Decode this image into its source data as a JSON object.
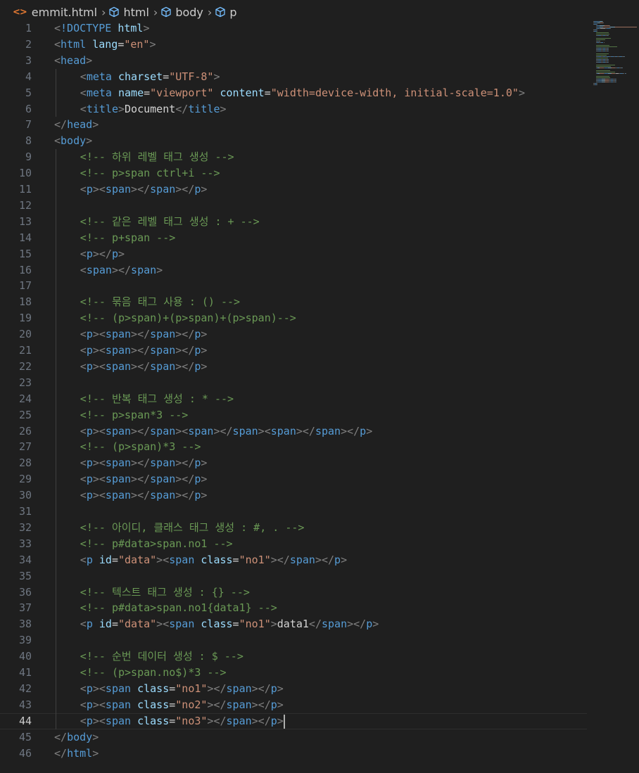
{
  "breadcrumb": {
    "file_icon": "<>",
    "items": [
      "emmit.html",
      "html",
      "body",
      "p"
    ]
  },
  "editor": {
    "active_line": 44,
    "lines": [
      {
        "n": "1",
        "indent": 0,
        "tokens": [
          [
            "b",
            "<"
          ],
          [
            "t",
            "!DOCTYPE "
          ],
          [
            "a",
            "html"
          ],
          [
            "b",
            ">"
          ]
        ]
      },
      {
        "n": "2",
        "indent": 0,
        "tokens": [
          [
            "b",
            "<"
          ],
          [
            "t",
            "html "
          ],
          [
            "a",
            "lang"
          ],
          [
            "x",
            "="
          ],
          [
            "s",
            "\"en\""
          ],
          [
            "b",
            ">"
          ]
        ]
      },
      {
        "n": "3",
        "indent": 0,
        "tokens": [
          [
            "b",
            "<"
          ],
          [
            "t",
            "head"
          ],
          [
            "b",
            ">"
          ]
        ]
      },
      {
        "n": "4",
        "indent": 1,
        "tokens": [
          [
            "b",
            "<"
          ],
          [
            "t",
            "meta "
          ],
          [
            "a",
            "charset"
          ],
          [
            "x",
            "="
          ],
          [
            "s",
            "\"UTF-8\""
          ],
          [
            "b",
            ">"
          ]
        ]
      },
      {
        "n": "5",
        "indent": 1,
        "tokens": [
          [
            "b",
            "<"
          ],
          [
            "t",
            "meta "
          ],
          [
            "a",
            "name"
          ],
          [
            "x",
            "="
          ],
          [
            "s",
            "\"viewport\""
          ],
          [
            "x",
            " "
          ],
          [
            "a",
            "content"
          ],
          [
            "x",
            "="
          ],
          [
            "s",
            "\"width=device-width, initial-scale=1.0\""
          ],
          [
            "b",
            ">"
          ]
        ]
      },
      {
        "n": "6",
        "indent": 1,
        "tokens": [
          [
            "b",
            "<"
          ],
          [
            "t",
            "title"
          ],
          [
            "b",
            ">"
          ],
          [
            "x",
            "Document"
          ],
          [
            "b",
            "</"
          ],
          [
            "t",
            "title"
          ],
          [
            "b",
            ">"
          ]
        ]
      },
      {
        "n": "7",
        "indent": 0,
        "tokens": [
          [
            "b",
            "</"
          ],
          [
            "t",
            "head"
          ],
          [
            "b",
            ">"
          ]
        ]
      },
      {
        "n": "8",
        "indent": 0,
        "tokens": [
          [
            "b",
            "<"
          ],
          [
            "t",
            "body"
          ],
          [
            "b",
            ">"
          ]
        ]
      },
      {
        "n": "9",
        "indent": 1,
        "tokens": [
          [
            "c",
            "<!-- 하위 레벨 태그 생성 -->"
          ]
        ]
      },
      {
        "n": "10",
        "indent": 1,
        "tokens": [
          [
            "c",
            "<!-- p>span ctrl+i -->"
          ]
        ]
      },
      {
        "n": "11",
        "indent": 1,
        "tokens": [
          [
            "b",
            "<"
          ],
          [
            "t",
            "p"
          ],
          [
            "b",
            "><"
          ],
          [
            "t",
            "span"
          ],
          [
            "b",
            "></"
          ],
          [
            "t",
            "span"
          ],
          [
            "b",
            "></"
          ],
          [
            "t",
            "p"
          ],
          [
            "b",
            ">"
          ]
        ]
      },
      {
        "n": "12",
        "indent": 0,
        "tokens": []
      },
      {
        "n": "13",
        "indent": 1,
        "tokens": [
          [
            "c",
            "<!-- 같은 레벨 태그 생성 : + -->"
          ]
        ]
      },
      {
        "n": "14",
        "indent": 1,
        "tokens": [
          [
            "c",
            "<!-- p+span -->"
          ]
        ]
      },
      {
        "n": "15",
        "indent": 1,
        "tokens": [
          [
            "b",
            "<"
          ],
          [
            "t",
            "p"
          ],
          [
            "b",
            "></"
          ],
          [
            "t",
            "p"
          ],
          [
            "b",
            ">"
          ]
        ]
      },
      {
        "n": "16",
        "indent": 1,
        "tokens": [
          [
            "b",
            "<"
          ],
          [
            "t",
            "span"
          ],
          [
            "b",
            "></"
          ],
          [
            "t",
            "span"
          ],
          [
            "b",
            ">"
          ]
        ]
      },
      {
        "n": "17",
        "indent": 0,
        "tokens": []
      },
      {
        "n": "18",
        "indent": 1,
        "tokens": [
          [
            "c",
            "<!-- 묶음 태그 사용 : () -->"
          ]
        ]
      },
      {
        "n": "19",
        "indent": 1,
        "tokens": [
          [
            "c",
            "<!-- (p>span)+(p>span)+(p>span)-->"
          ]
        ]
      },
      {
        "n": "20",
        "indent": 1,
        "tokens": [
          [
            "b",
            "<"
          ],
          [
            "t",
            "p"
          ],
          [
            "b",
            "><"
          ],
          [
            "t",
            "span"
          ],
          [
            "b",
            "></"
          ],
          [
            "t",
            "span"
          ],
          [
            "b",
            "></"
          ],
          [
            "t",
            "p"
          ],
          [
            "b",
            ">"
          ]
        ]
      },
      {
        "n": "21",
        "indent": 1,
        "tokens": [
          [
            "b",
            "<"
          ],
          [
            "t",
            "p"
          ],
          [
            "b",
            "><"
          ],
          [
            "t",
            "span"
          ],
          [
            "b",
            "></"
          ],
          [
            "t",
            "span"
          ],
          [
            "b",
            "></"
          ],
          [
            "t",
            "p"
          ],
          [
            "b",
            ">"
          ]
        ]
      },
      {
        "n": "22",
        "indent": 1,
        "tokens": [
          [
            "b",
            "<"
          ],
          [
            "t",
            "p"
          ],
          [
            "b",
            "><"
          ],
          [
            "t",
            "span"
          ],
          [
            "b",
            "></"
          ],
          [
            "t",
            "span"
          ],
          [
            "b",
            "></"
          ],
          [
            "t",
            "p"
          ],
          [
            "b",
            ">"
          ]
        ]
      },
      {
        "n": "23",
        "indent": 0,
        "tokens": []
      },
      {
        "n": "24",
        "indent": 1,
        "tokens": [
          [
            "c",
            "<!-- 반복 태그 생성 : * -->"
          ]
        ]
      },
      {
        "n": "25",
        "indent": 1,
        "tokens": [
          [
            "c",
            "<!-- p>span*3 -->"
          ]
        ]
      },
      {
        "n": "26",
        "indent": 1,
        "tokens": [
          [
            "b",
            "<"
          ],
          [
            "t",
            "p"
          ],
          [
            "b",
            "><"
          ],
          [
            "t",
            "span"
          ],
          [
            "b",
            "></"
          ],
          [
            "t",
            "span"
          ],
          [
            "b",
            "><"
          ],
          [
            "t",
            "span"
          ],
          [
            "b",
            "></"
          ],
          [
            "t",
            "span"
          ],
          [
            "b",
            "><"
          ],
          [
            "t",
            "span"
          ],
          [
            "b",
            "></"
          ],
          [
            "t",
            "span"
          ],
          [
            "b",
            "></"
          ],
          [
            "t",
            "p"
          ],
          [
            "b",
            ">"
          ]
        ]
      },
      {
        "n": "27",
        "indent": 1,
        "tokens": [
          [
            "c",
            "<!-- (p>span)*3 -->"
          ]
        ]
      },
      {
        "n": "28",
        "indent": 1,
        "tokens": [
          [
            "b",
            "<"
          ],
          [
            "t",
            "p"
          ],
          [
            "b",
            "><"
          ],
          [
            "t",
            "span"
          ],
          [
            "b",
            "></"
          ],
          [
            "t",
            "span"
          ],
          [
            "b",
            "></"
          ],
          [
            "t",
            "p"
          ],
          [
            "b",
            ">"
          ]
        ]
      },
      {
        "n": "29",
        "indent": 1,
        "tokens": [
          [
            "b",
            "<"
          ],
          [
            "t",
            "p"
          ],
          [
            "b",
            "><"
          ],
          [
            "t",
            "span"
          ],
          [
            "b",
            "></"
          ],
          [
            "t",
            "span"
          ],
          [
            "b",
            "></"
          ],
          [
            "t",
            "p"
          ],
          [
            "b",
            ">"
          ]
        ]
      },
      {
        "n": "30",
        "indent": 1,
        "tokens": [
          [
            "b",
            "<"
          ],
          [
            "t",
            "p"
          ],
          [
            "b",
            "><"
          ],
          [
            "t",
            "span"
          ],
          [
            "b",
            "></"
          ],
          [
            "t",
            "span"
          ],
          [
            "b",
            "></"
          ],
          [
            "t",
            "p"
          ],
          [
            "b",
            ">"
          ]
        ]
      },
      {
        "n": "31",
        "indent": 0,
        "tokens": []
      },
      {
        "n": "32",
        "indent": 1,
        "tokens": [
          [
            "c",
            "<!-- 아이디, 클래스 태그 생성 : #, . -->"
          ]
        ]
      },
      {
        "n": "33",
        "indent": 1,
        "tokens": [
          [
            "c",
            "<!-- p#data>span.no1 -->"
          ]
        ]
      },
      {
        "n": "34",
        "indent": 1,
        "tokens": [
          [
            "b",
            "<"
          ],
          [
            "t",
            "p "
          ],
          [
            "a",
            "id"
          ],
          [
            "x",
            "="
          ],
          [
            "s",
            "\"data\""
          ],
          [
            "b",
            "><"
          ],
          [
            "t",
            "span "
          ],
          [
            "a",
            "class"
          ],
          [
            "x",
            "="
          ],
          [
            "s",
            "\"no1\""
          ],
          [
            "b",
            "></"
          ],
          [
            "t",
            "span"
          ],
          [
            "b",
            "></"
          ],
          [
            "t",
            "p"
          ],
          [
            "b",
            ">"
          ]
        ]
      },
      {
        "n": "35",
        "indent": 0,
        "tokens": []
      },
      {
        "n": "36",
        "indent": 1,
        "tokens": [
          [
            "c",
            "<!-- 텍스트 태그 생성 : {} -->"
          ]
        ]
      },
      {
        "n": "37",
        "indent": 1,
        "tokens": [
          [
            "c",
            "<!-- p#data>span.no1{data1} -->"
          ]
        ]
      },
      {
        "n": "38",
        "indent": 1,
        "tokens": [
          [
            "b",
            "<"
          ],
          [
            "t",
            "p "
          ],
          [
            "a",
            "id"
          ],
          [
            "x",
            "="
          ],
          [
            "s",
            "\"data\""
          ],
          [
            "b",
            "><"
          ],
          [
            "t",
            "span "
          ],
          [
            "a",
            "class"
          ],
          [
            "x",
            "="
          ],
          [
            "s",
            "\"no1\""
          ],
          [
            "b",
            ">"
          ],
          [
            "x",
            "data1"
          ],
          [
            "b",
            "</"
          ],
          [
            "t",
            "span"
          ],
          [
            "b",
            "></"
          ],
          [
            "t",
            "p"
          ],
          [
            "b",
            ">"
          ]
        ]
      },
      {
        "n": "39",
        "indent": 0,
        "tokens": []
      },
      {
        "n": "40",
        "indent": 1,
        "tokens": [
          [
            "c",
            "<!-- 순번 데이터 생성 : $ -->"
          ]
        ]
      },
      {
        "n": "41",
        "indent": 1,
        "tokens": [
          [
            "c",
            "<!-- (p>span.no$)*3 -->"
          ]
        ]
      },
      {
        "n": "42",
        "indent": 1,
        "tokens": [
          [
            "b",
            "<"
          ],
          [
            "t",
            "p"
          ],
          [
            "b",
            "><"
          ],
          [
            "t",
            "span "
          ],
          [
            "a",
            "class"
          ],
          [
            "x",
            "="
          ],
          [
            "s",
            "\"no1\""
          ],
          [
            "b",
            "></"
          ],
          [
            "t",
            "span"
          ],
          [
            "b",
            "></"
          ],
          [
            "t",
            "p"
          ],
          [
            "b",
            ">"
          ]
        ]
      },
      {
        "n": "43",
        "indent": 1,
        "tokens": [
          [
            "b",
            "<"
          ],
          [
            "t",
            "p"
          ],
          [
            "b",
            "><"
          ],
          [
            "t",
            "span "
          ],
          [
            "a",
            "class"
          ],
          [
            "x",
            "="
          ],
          [
            "s",
            "\"no2\""
          ],
          [
            "b",
            "></"
          ],
          [
            "t",
            "span"
          ],
          [
            "b",
            "></"
          ],
          [
            "t",
            "p"
          ],
          [
            "b",
            ">"
          ]
        ]
      },
      {
        "n": "44",
        "indent": 1,
        "tokens": [
          [
            "b",
            "<"
          ],
          [
            "t",
            "p"
          ],
          [
            "b",
            "><"
          ],
          [
            "t",
            "span "
          ],
          [
            "a",
            "class"
          ],
          [
            "x",
            "="
          ],
          [
            "s",
            "\"no3\""
          ],
          [
            "b",
            "></"
          ],
          [
            "t",
            "span"
          ],
          [
            "b",
            "></"
          ],
          [
            "t",
            "p"
          ],
          [
            "b",
            ">"
          ]
        ]
      },
      {
        "n": "45",
        "indent": 0,
        "tokens": [
          [
            "b",
            "</"
          ],
          [
            "t",
            "body"
          ],
          [
            "b",
            ">"
          ]
        ]
      },
      {
        "n": "46",
        "indent": 0,
        "tokens": [
          [
            "b",
            "</"
          ],
          [
            "t",
            "html"
          ],
          [
            "b",
            ">"
          ]
        ]
      }
    ]
  },
  "colors": {
    "background": "#1f1f1f",
    "tag": "#569cd6",
    "attribute": "#9cdcfe",
    "string": "#ce9178",
    "comment": "#6a9955",
    "bracket": "#808080",
    "text": "#d4d4d4",
    "line_number": "#6e7681",
    "file_icon": "#e37933"
  }
}
